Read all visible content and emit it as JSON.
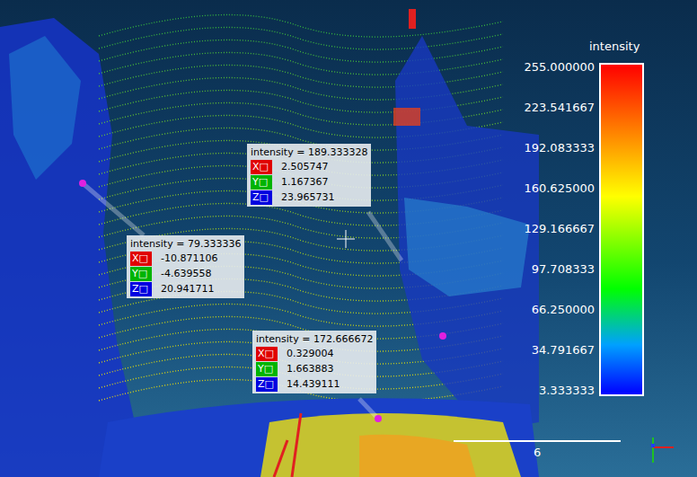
{
  "labels": [
    {
      "title": "intensity = 189.333328",
      "coords": [
        {
          "axis": "X□",
          "value": "2.505747",
          "color": "#e00000"
        },
        {
          "axis": "Y□",
          "value": "1.167367",
          "color": "#00b400"
        },
        {
          "axis": "Z□",
          "value": "23.965731",
          "color": "#0000e0"
        }
      ]
    },
    {
      "title": "intensity = 79.333336",
      "coords": [
        {
          "axis": "X□",
          "value": "-10.871106",
          "color": "#e00000"
        },
        {
          "axis": "Y□",
          "value": "-4.639558",
          "color": "#00b400"
        },
        {
          "axis": "Z□",
          "value": "20.941711",
          "color": "#0000e0"
        }
      ]
    },
    {
      "title": "intensity = 172.666672",
      "coords": [
        {
          "axis": "X□",
          "value": "0.329004",
          "color": "#e00000"
        },
        {
          "axis": "Y□",
          "value": "1.663883",
          "color": "#00b400"
        },
        {
          "axis": "Z□",
          "value": "14.439111",
          "color": "#0000e0"
        }
      ]
    }
  ],
  "color_scale": {
    "title": "intensity",
    "ticks": [
      "255.000000",
      "223.541667",
      "192.083333",
      "160.625000",
      "129.166667",
      "97.708333",
      "66.250000",
      "34.791667",
      "3.333333"
    ]
  },
  "scale_bar": {
    "label": "6"
  }
}
